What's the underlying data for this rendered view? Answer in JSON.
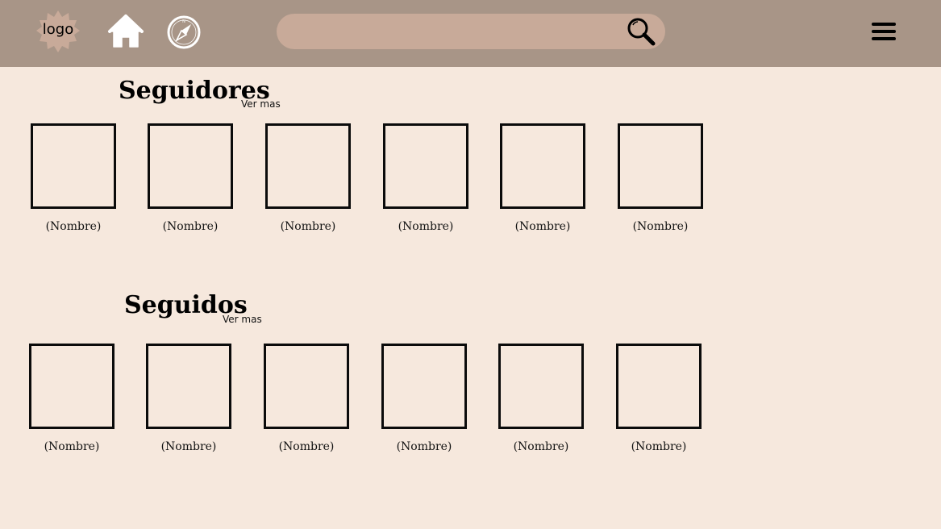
{
  "header": {
    "logo_text": "logo",
    "home_icon": "home-icon",
    "compass_icon": "compass-icon",
    "search": {
      "value": "",
      "placeholder": ""
    },
    "search_icon": "search-icon",
    "menu_icon": "hamburger-menu-icon"
  },
  "colors": {
    "background": "#f6e8dd",
    "header": "#a89587",
    "search_bar": "#c8aa99",
    "logo_badge": "#c8aa99"
  },
  "followers": {
    "title": "Seguidores",
    "see_more": "Ver mas",
    "items": [
      {
        "name": "(Nombre)"
      },
      {
        "name": "(Nombre)"
      },
      {
        "name": "(Nombre)"
      },
      {
        "name": "(Nombre)"
      },
      {
        "name": "(Nombre)"
      },
      {
        "name": "(Nombre)"
      }
    ]
  },
  "following": {
    "title": "Seguidos",
    "see_more": "Ver mas",
    "items": [
      {
        "name": "(Nombre)"
      },
      {
        "name": "(Nombre)"
      },
      {
        "name": "(Nombre)"
      },
      {
        "name": "(Nombre)"
      },
      {
        "name": "(Nombre)"
      },
      {
        "name": "(Nombre)"
      }
    ]
  }
}
